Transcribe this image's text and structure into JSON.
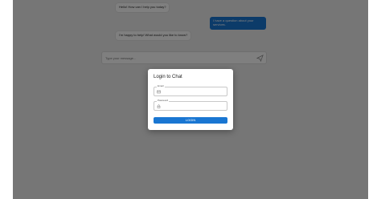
{
  "chat": {
    "messages": [
      {
        "role": "bot",
        "text": "Hello! How can I help you today?"
      },
      {
        "role": "user",
        "text": "I have a question about your services."
      },
      {
        "role": "bot",
        "text": "I'm happy to help! What would you like to know?"
      }
    ],
    "composer": {
      "placeholder": "Type your message..."
    }
  },
  "login_dialog": {
    "title": "Login to Chat",
    "email_label": "Email",
    "password_label": "Password",
    "submit_label": "LOGIN"
  },
  "colors": {
    "accent": "#1976d2",
    "overlay": "rgba(0,0,0,0.5)",
    "page_background": "#ececec"
  },
  "icons": {
    "send": "send-icon",
    "email": "email-icon",
    "password": "lock-icon"
  }
}
